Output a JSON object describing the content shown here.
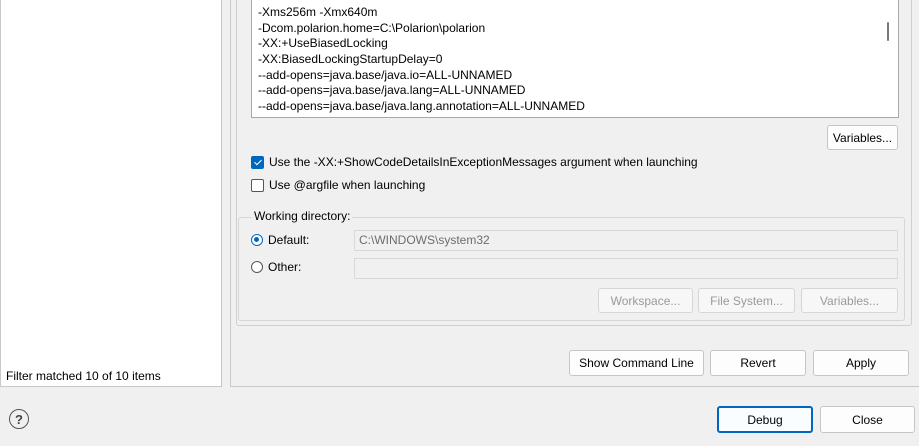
{
  "left_panel": {
    "filter_status": "Filter matched 10 of 10 items"
  },
  "arguments": {
    "vm_args": [
      "-Xms256m -Xmx640m",
      "-Dcom.polarion.home=C:\\Polarion\\polarion",
      "-XX:+UseBiasedLocking",
      "-XX:BiasedLockingStartupDelay=0",
      "--add-opens=java.base/java.io=ALL-UNNAMED",
      "--add-opens=java.base/java.lang=ALL-UNNAMED",
      "--add-opens=java.base/java.lang.annotation=ALL-UNNAMED"
    ],
    "variables_label": "Variables...",
    "show_code_details": {
      "label": "Use the -XX:+ShowCodeDetailsInExceptionMessages argument when launching",
      "checked": true
    },
    "argfile": {
      "label": "Use @argfile when launching",
      "checked": false
    }
  },
  "working_directory": {
    "legend": "Working directory:",
    "default_label": "Default:",
    "default_value": "C:\\WINDOWS\\system32",
    "default_selected": true,
    "other_label": "Other:",
    "other_value": "",
    "workspace_label": "Workspace...",
    "file_system_label": "File System...",
    "variables_label": "Variables..."
  },
  "actions": {
    "show_command_line": "Show Command Line",
    "revert": "Revert",
    "apply": "Apply"
  },
  "dialog": {
    "help_icon": "question-mark-icon",
    "debug": "Debug",
    "close": "Close"
  },
  "colors": {
    "accent": "#0067c0",
    "background": "#f0f0f0"
  }
}
